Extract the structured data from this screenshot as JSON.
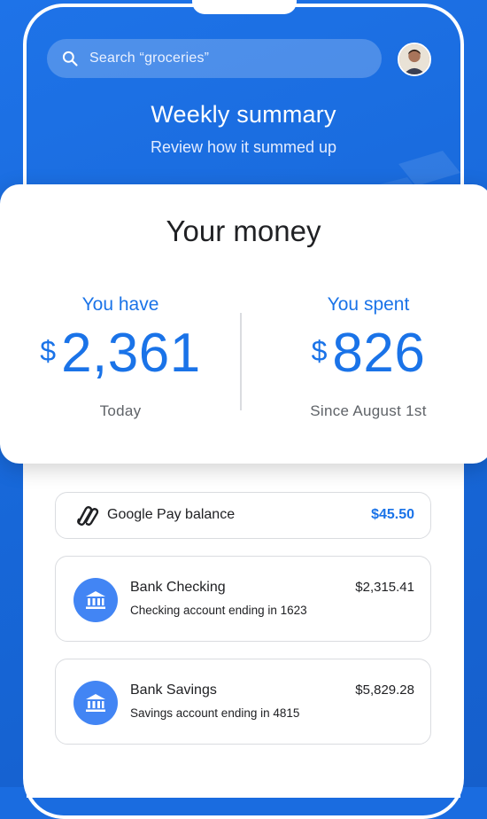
{
  "header": {
    "search_placeholder": "Search “groceries”",
    "title": "Weekly summary",
    "subtitle": "Review how it summed up"
  },
  "card": {
    "title": "Your money",
    "have": {
      "label": "You have",
      "currency": "$",
      "amount": "2,361",
      "sub": "Today"
    },
    "spent": {
      "label": "You spent",
      "currency": "$",
      "amount": "826",
      "sub": "Since August 1st"
    }
  },
  "accounts": {
    "gpay": {
      "label": "Google Pay balance",
      "amount": "$45.50"
    },
    "checking": {
      "name": "Bank Checking",
      "sub": "Checking account ending in 1623",
      "amount": "$2,315.41"
    },
    "savings": {
      "name": "Bank Savings",
      "sub": "Savings account ending in 4815",
      "amount": "$5,829.28"
    }
  },
  "colors": {
    "accent": "#1a73e8",
    "background": "#1a6ce0",
    "bank_icon_bg": "#4285f4"
  },
  "icons": [
    "search-icon",
    "avatar",
    "google-pay-icon",
    "bank-icon"
  ]
}
